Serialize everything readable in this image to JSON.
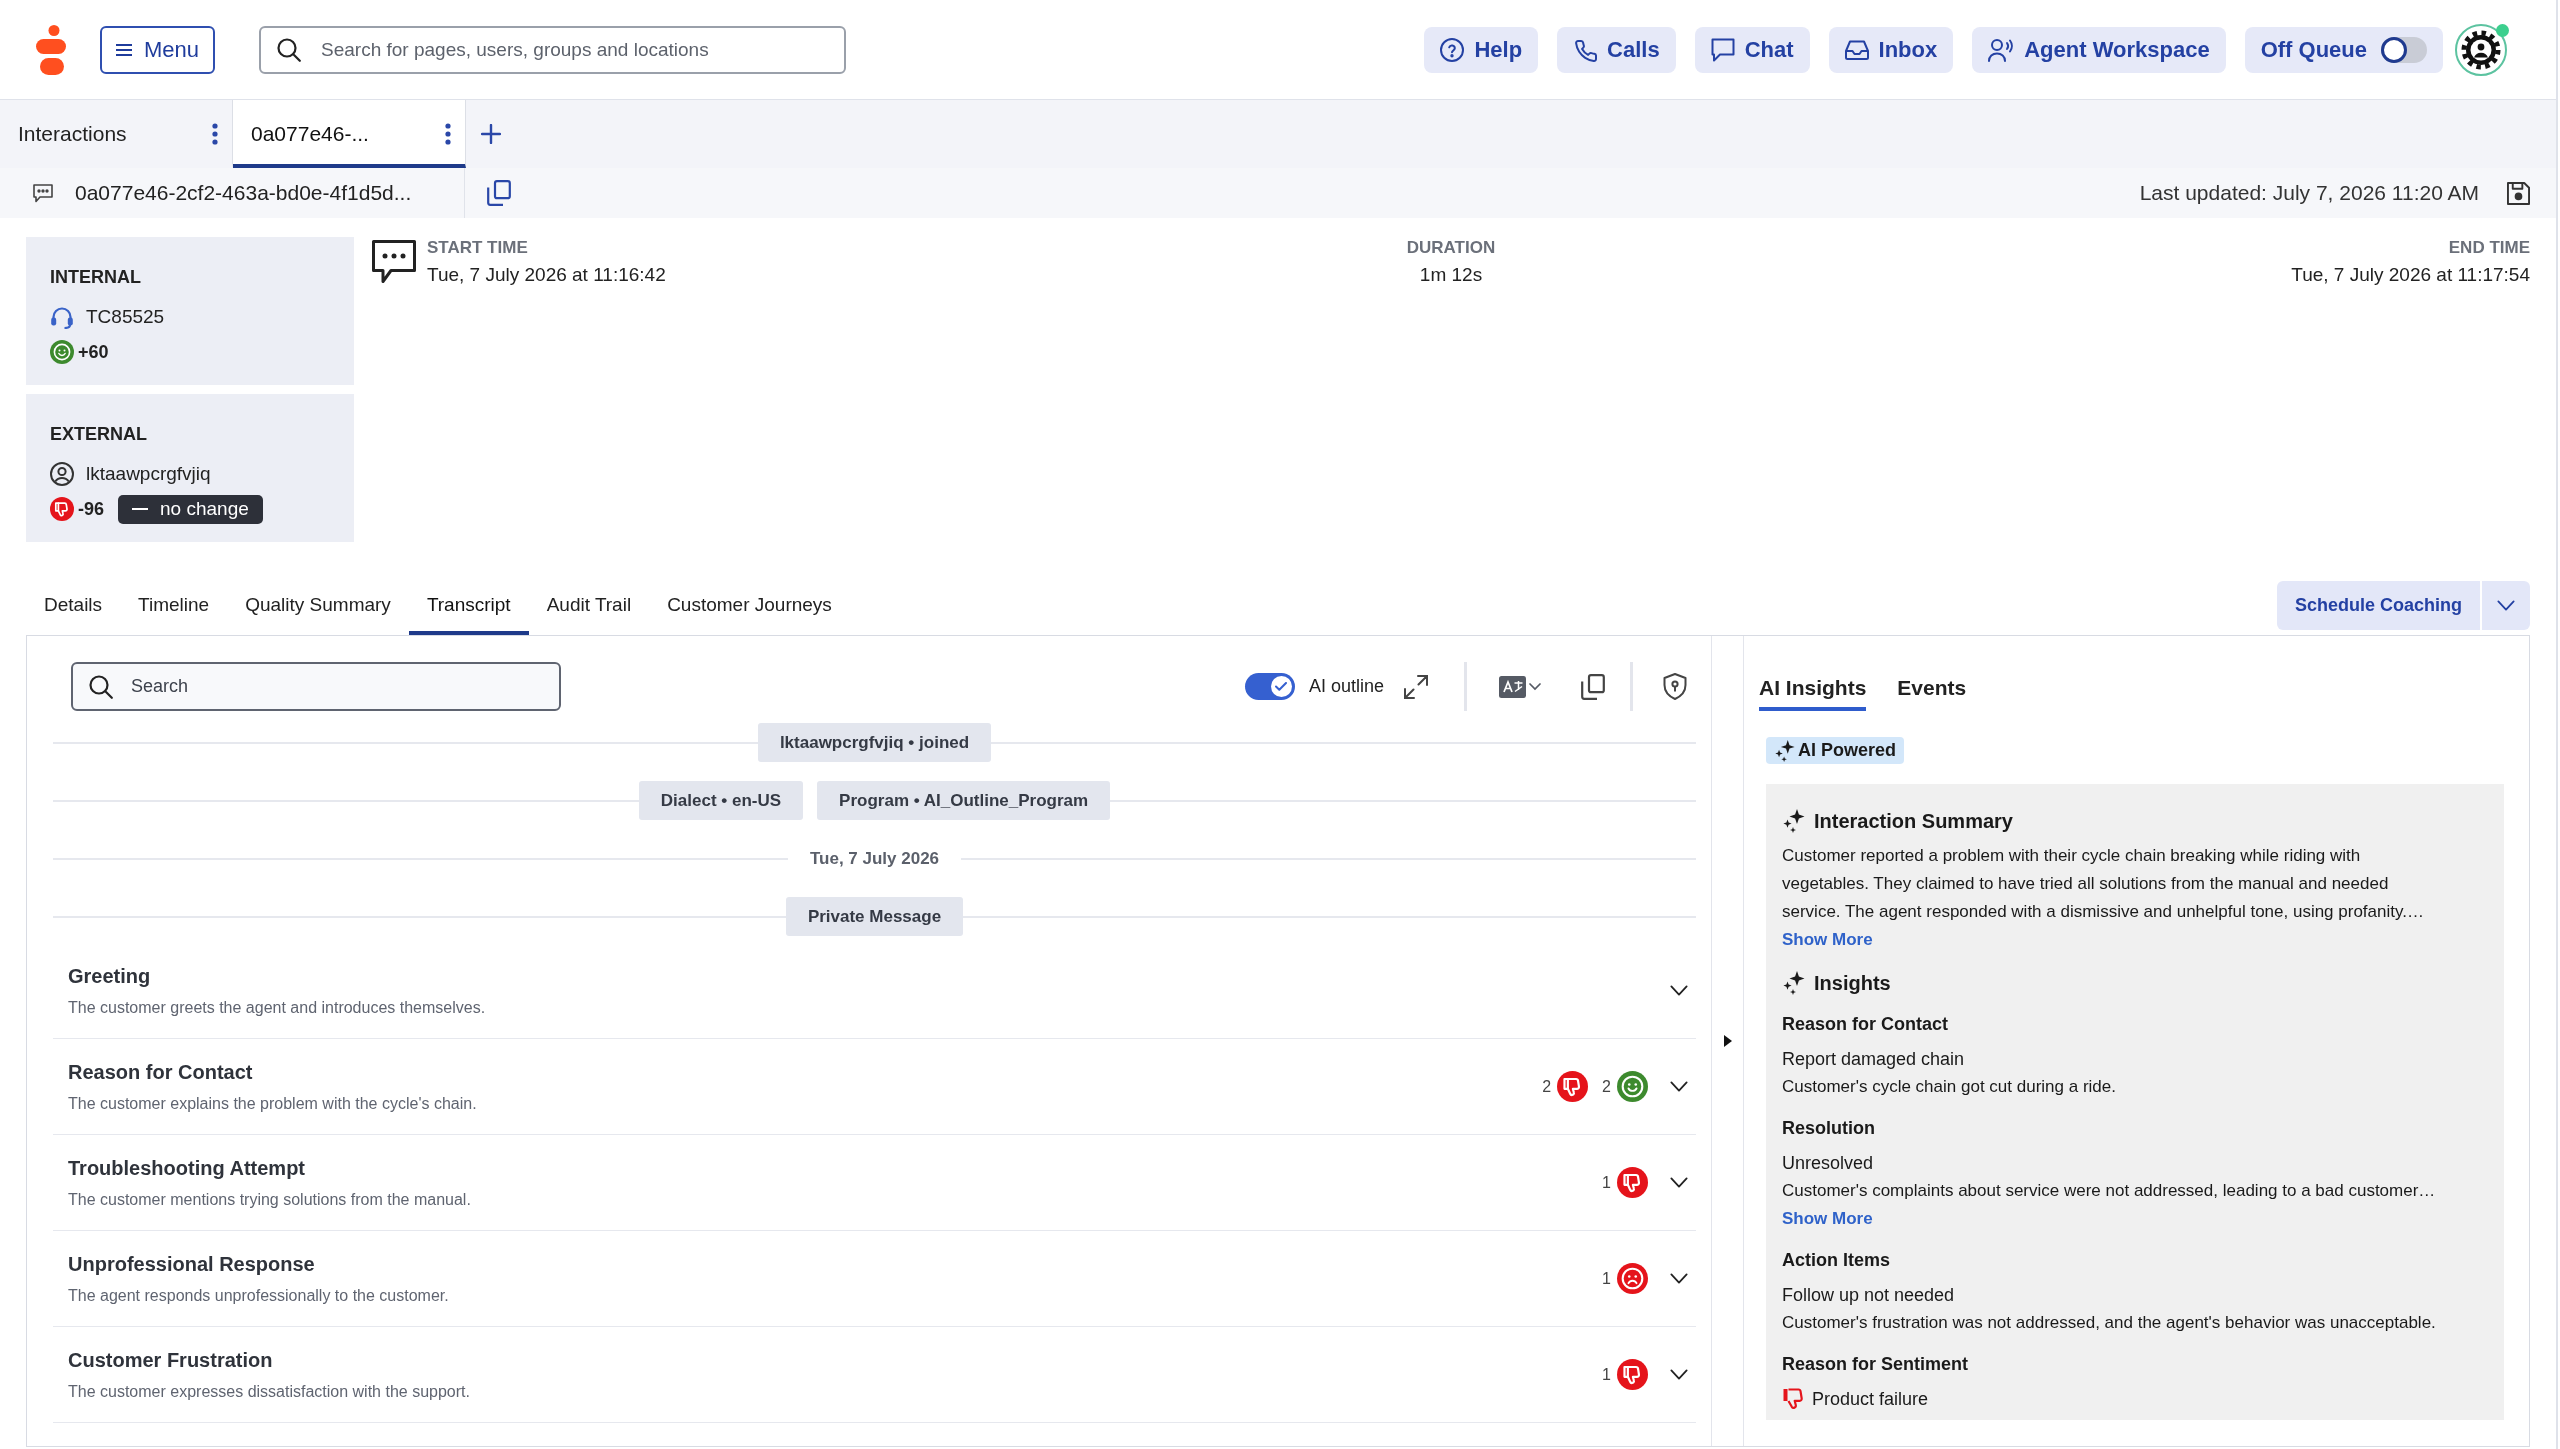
{
  "top_bar": {
    "menu_button": "Menu",
    "search": {
      "placeholder": "Search for pages, users, groups and locations"
    },
    "buttons": [
      {
        "kind": "help",
        "label": "Help"
      },
      {
        "kind": "calls",
        "label": "Calls"
      },
      {
        "kind": "chat",
        "label": "Chat"
      },
      {
        "kind": "inbox",
        "label": "Inbox"
      },
      {
        "kind": "agent",
        "label": "Agent Workspace"
      }
    ],
    "queue_toggle": {
      "label": "Off Queue",
      "on": false
    },
    "user": {
      "online": true
    }
  },
  "workspace_tabs": [
    {
      "label": "Interactions",
      "selected": false
    },
    {
      "label": "0a077e46-...",
      "selected": true
    }
  ],
  "interaction_bar": {
    "id": "0a077e46-2cf2-463a-bd0e-4f1d5d...",
    "last_updated": "Last updated: July 7, 2026 11:20 AM"
  },
  "participants": [
    {
      "role": "INTERNAL",
      "kind": "agent",
      "name": "TC85525",
      "sentiment": {
        "kind": "positive",
        "score": "+60"
      }
    },
    {
      "role": "EXTERNAL",
      "kind": "customer",
      "name": "lktaawpcrgfvjiq",
      "sentiment": {
        "kind": "negative",
        "score": "-96",
        "trend": "no change"
      }
    }
  ],
  "timing": [
    {
      "label": "START TIME",
      "value": "Tue, 7 July 2026 at 11:16:42"
    },
    {
      "label": "DURATION",
      "value": "1m 12s"
    },
    {
      "label": "END TIME",
      "value": "Tue, 7 July 2026 at 11:17:54"
    }
  ],
  "detail_tabs": [
    {
      "label": "Details",
      "selected": false
    },
    {
      "label": "Timeline",
      "selected": false
    },
    {
      "label": "Quality Summary",
      "selected": false
    },
    {
      "label": "Transcript",
      "selected": true
    },
    {
      "label": "Audit Trail",
      "selected": false
    },
    {
      "label": "Customer Journeys",
      "selected": false
    }
  ],
  "schedule_button": {
    "label": "Schedule Coaching"
  },
  "transcript": {
    "search": {
      "placeholder": "Search"
    },
    "ai_outline": {
      "label": "AI outline",
      "on": true
    },
    "events": [
      {
        "kind": "pill",
        "items": [
          "lktaawpcrgfvjiq • joined"
        ]
      },
      {
        "kind": "pill",
        "items": [
          "Dialect • en-US",
          "Program • AI_Outline_Program"
        ]
      },
      {
        "kind": "date",
        "text": "Tue, 7 July 2026"
      },
      {
        "kind": "pill",
        "items": [
          "Private Message"
        ]
      }
    ],
    "outline": [
      {
        "title": "Greeting",
        "description": "The customer greets the agent and introduces themselves.",
        "expanded": false
      },
      {
        "title": "Reason for Contact",
        "description": "The customer explains the problem with the cycle's chain.",
        "expanded": false,
        "badges": [
          {
            "count": "2",
            "kind": "negative"
          },
          {
            "count": "2",
            "kind": "positive"
          }
        ]
      },
      {
        "title": "Troubleshooting Attempt",
        "description": "The customer mentions trying solutions from the manual.",
        "expanded": false,
        "badges": [
          {
            "count": "1",
            "kind": "negative"
          }
        ]
      },
      {
        "title": "Unprofessional Response",
        "description": "The agent responds unprofessionally to the customer.",
        "expanded": false,
        "badges": [
          {
            "count": "1",
            "kind": "upset"
          }
        ]
      },
      {
        "title": "Customer Frustration",
        "description": "The customer expresses dissatisfaction with the support.",
        "expanded": false,
        "badges": [
          {
            "count": "1",
            "kind": "negative"
          }
        ]
      }
    ]
  },
  "insights_panel": {
    "tabs": [
      {
        "label": "AI Insights",
        "selected": true
      },
      {
        "label": "Events",
        "selected": false
      }
    ],
    "badge": "AI Powered",
    "summary": {
      "title": "Interaction Summary",
      "text": "Customer reported a problem with their cycle chain breaking while riding with vegetables. They claimed to have tried all solutions from the manual and needed service. The agent responded with a dismissive and unhelpful tone, using profanity.…",
      "link": "Show More"
    },
    "insights": {
      "title": "Insights",
      "sections": [
        {
          "kind": "text",
          "title": "Reason for Contact",
          "value": "Report damaged chain",
          "detail": "Customer's cycle chain got cut during a ride."
        },
        {
          "kind": "text",
          "title": "Resolution",
          "value": "Unresolved",
          "detail": "Customer's complaints about service were not addressed, leading to a bad customer…",
          "link": "Show More"
        },
        {
          "kind": "text",
          "title": "Action Items",
          "value": "Follow up not needed",
          "detail": "Customer's frustration was not addressed, and the agent's behavior was unacceptable."
        },
        {
          "kind": "negative",
          "title": "Reason for Sentiment",
          "value": "Product failure"
        }
      ]
    }
  }
}
